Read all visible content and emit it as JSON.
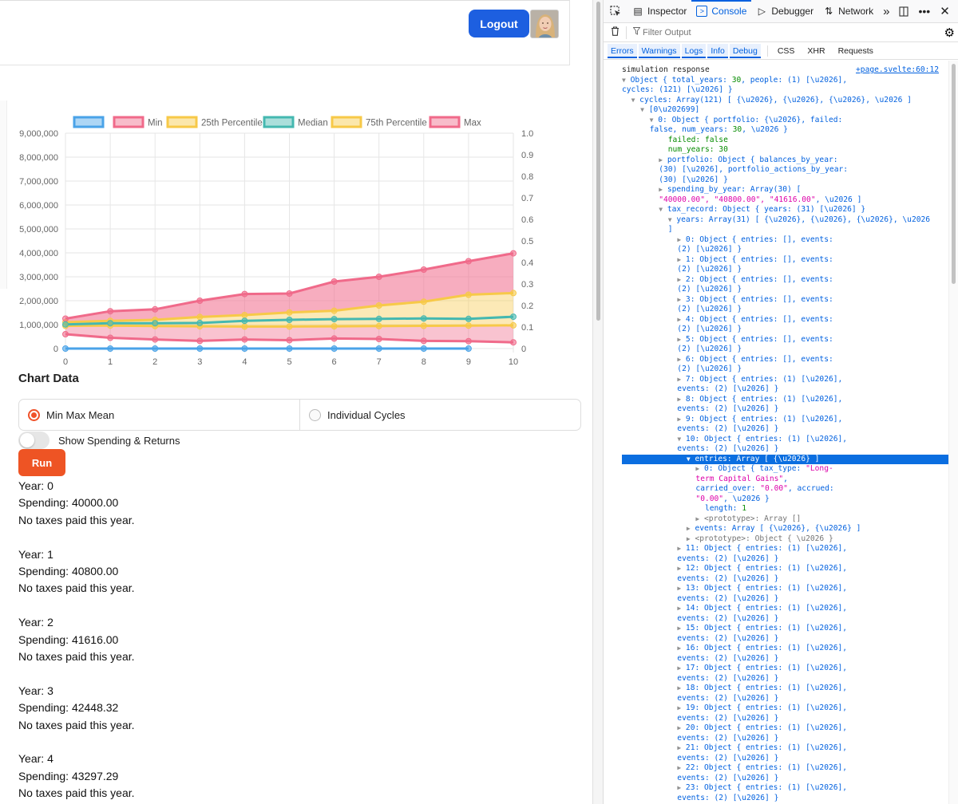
{
  "header": {
    "logout_label": "Logout"
  },
  "chart_data": {
    "type": "line",
    "x": [
      0,
      1,
      2,
      3,
      4,
      5,
      6,
      7,
      8,
      9,
      10
    ],
    "ylim": [
      0,
      9000000
    ],
    "y2lim": [
      0,
      1.0
    ],
    "y_ticks": [
      "9,000,000",
      "8,000,000",
      "7,000,000",
      "6,000,000",
      "5,000,000",
      "4,000,000",
      "3,000,000",
      "2,000,000",
      "1,000,000",
      "0"
    ],
    "y2_ticks": [
      "1.0",
      "0.9",
      "0.8",
      "0.7",
      "0.6",
      "0.5",
      "0.4",
      "0.3",
      "0.2",
      "0.1",
      "0"
    ],
    "x_ticks": [
      "0",
      "1",
      "2",
      "3",
      "4",
      "5",
      "6",
      "7",
      "8",
      "9",
      "10"
    ],
    "legend_position": "top",
    "grid": true,
    "series": [
      {
        "name": "",
        "color": "#4aa3e8",
        "values": [
          0,
          0,
          0,
          0,
          0,
          0,
          0,
          0,
          0,
          0,
          null
        ]
      },
      {
        "name": "Min",
        "color": "#f06a8a",
        "values": [
          600000,
          450000,
          380000,
          320000,
          380000,
          350000,
          420000,
          400000,
          320000,
          310000,
          260000
        ]
      },
      {
        "name": "25th Percentile",
        "color": "#f7c948",
        "values": [
          950000,
          960000,
          940000,
          930000,
          920000,
          920000,
          930000,
          940000,
          950000,
          960000,
          970000
        ]
      },
      {
        "name": "Median",
        "color": "#45b8b0",
        "values": [
          1010000,
          1060000,
          1060000,
          1070000,
          1160000,
          1200000,
          1230000,
          1240000,
          1260000,
          1240000,
          1330000
        ]
      },
      {
        "name": "75th Percentile",
        "color": "#f7c948",
        "values": [
          1100000,
          1160000,
          1200000,
          1320000,
          1400000,
          1510000,
          1580000,
          1800000,
          1960000,
          2250000,
          2320000
        ]
      },
      {
        "name": "Max",
        "color": "#f06a8a",
        "values": [
          1250000,
          1560000,
          1640000,
          2000000,
          2280000,
          2300000,
          2800000,
          3000000,
          3300000,
          3650000,
          3980000
        ]
      }
    ]
  },
  "controls": {
    "chart_data_title": "Chart Data",
    "mode_options": [
      "Min Max Mean",
      "Individual Cycles"
    ],
    "toggle_label": "Show Spending & Returns",
    "run_label": "Run"
  },
  "results": [
    {
      "year": "Year: 0",
      "spending": "Spending: 40000.00",
      "taxes": "No taxes paid this year."
    },
    {
      "year": "Year: 1",
      "spending": "Spending: 40800.00",
      "taxes": "No taxes paid this year."
    },
    {
      "year": "Year: 2",
      "spending": "Spending: 41616.00",
      "taxes": "No taxes paid this year."
    },
    {
      "year": "Year: 3",
      "spending": "Spending: 42448.32",
      "taxes": "No taxes paid this year."
    },
    {
      "year": "Year: 4",
      "spending": "Spending: 43297.29",
      "taxes": "No taxes paid this year."
    }
  ],
  "devtools": {
    "tabs": [
      "Inspector",
      "Console",
      "Debugger",
      "Network"
    ],
    "filter_placeholder": "Filter Output",
    "filters": [
      "Errors",
      "Warnings",
      "Logs",
      "Info",
      "Debug"
    ],
    "filters_plain": [
      "CSS",
      "XHR",
      "Requests"
    ],
    "source_link": "+page.svelte:60:12",
    "log_title": "simulation response"
  }
}
